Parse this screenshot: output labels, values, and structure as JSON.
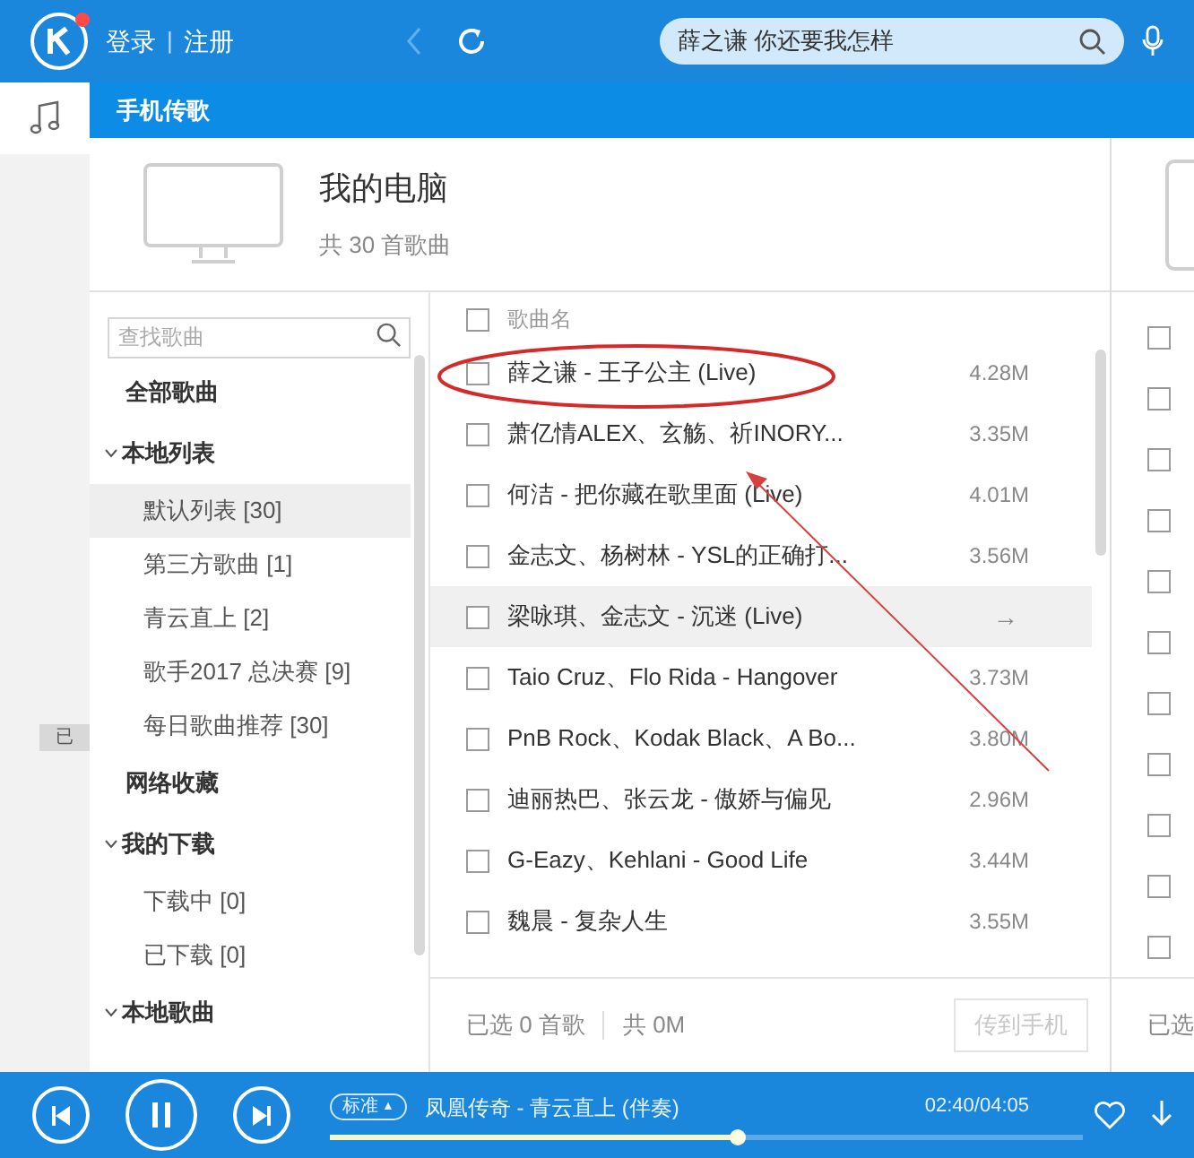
{
  "top_bar": {
    "login": "登录",
    "separator": "|",
    "register": "注册",
    "search": {
      "value": "薛之谦 你还要我怎样"
    }
  },
  "sub_bar": {
    "title": "手机传歌"
  },
  "side_badge": "已",
  "device": {
    "title": "我的电脑",
    "count": "共 30 首歌曲"
  },
  "sidebar": {
    "search": {
      "placeholder": "查找歌曲"
    },
    "items": [
      {
        "label": "全部歌曲",
        "selected": false
      },
      {
        "label": "本地列表",
        "expanded": true,
        "selected": false,
        "children": [
          {
            "label": "默认列表 [30]",
            "selected": true
          },
          {
            "label": "第三方歌曲 [1]",
            "selected": false
          },
          {
            "label": "青云直上 [2]",
            "selected": false
          },
          {
            "label": "歌手2017 总决赛 [9]",
            "selected": false
          },
          {
            "label": "每日歌曲推荐 [30]",
            "selected": false
          }
        ]
      },
      {
        "label": "网络收藏",
        "selected": false
      },
      {
        "label": "我的下载",
        "expanded": true,
        "selected": false,
        "children": [
          {
            "label": "下载中 [0]",
            "selected": false
          },
          {
            "label": "已下载 [0]",
            "selected": false
          }
        ]
      },
      {
        "label": "本地歌曲",
        "expanded": true,
        "selected": false
      }
    ]
  },
  "song_list": {
    "header": "歌曲名",
    "header_checked": false,
    "rows": [
      {
        "title": "薛之谦 - 王子公主 (Live)",
        "size": "4.28M",
        "checked": false,
        "hovered": false
      },
      {
        "title": "萧亿情ALEX、玄觞、祈INORY...",
        "size": "3.35M",
        "checked": false,
        "hovered": false
      },
      {
        "title": "何洁 - 把你藏在歌里面 (Live)",
        "size": "4.01M",
        "checked": false,
        "hovered": false
      },
      {
        "title": "金志文、杨树林 - YSL的正确打...",
        "size": "3.56M",
        "checked": false,
        "hovered": false
      },
      {
        "title": "梁咏琪、金志文 - 沉迷 (Live)",
        "action": "→",
        "checked": false,
        "hovered": true
      },
      {
        "title": "Taio Cruz、Flo Rida - Hangover",
        "size": "3.73M",
        "checked": false,
        "hovered": false
      },
      {
        "title": "PnB Rock、Kodak Black、A Bo...",
        "size": "3.80M",
        "checked": false,
        "hovered": false
      },
      {
        "title": "迪丽热巴、张云龙 - 傲娇与偏见",
        "size": "2.96M",
        "checked": false,
        "hovered": false
      },
      {
        "title": "G-Eazy、Kehlani - Good Life",
        "size": "3.44M",
        "checked": false,
        "hovered": false
      },
      {
        "title": "魏晨 - 复杂人生",
        "size": "3.55M",
        "checked": false,
        "hovered": false
      }
    ],
    "footer": {
      "selected": "已选 0 首歌",
      "total": "共 0M",
      "button": "传到手机",
      "button_disabled": true
    }
  },
  "phone_panel": {
    "rows": [
      {
        "checked": false
      },
      {
        "checked": false
      },
      {
        "checked": false
      },
      {
        "checked": false
      },
      {
        "checked": false
      },
      {
        "checked": false
      },
      {
        "checked": false
      },
      {
        "checked": false
      },
      {
        "checked": false
      },
      {
        "checked": false
      },
      {
        "checked": false
      }
    ],
    "footer": "已选"
  },
  "player": {
    "quality": "标准",
    "quality_caret": "▲",
    "song": "凤凰传奇 - 青云直上 (伴奏)",
    "time": "02:40/04:05",
    "progress": {
      "level": 0.54
    }
  }
}
